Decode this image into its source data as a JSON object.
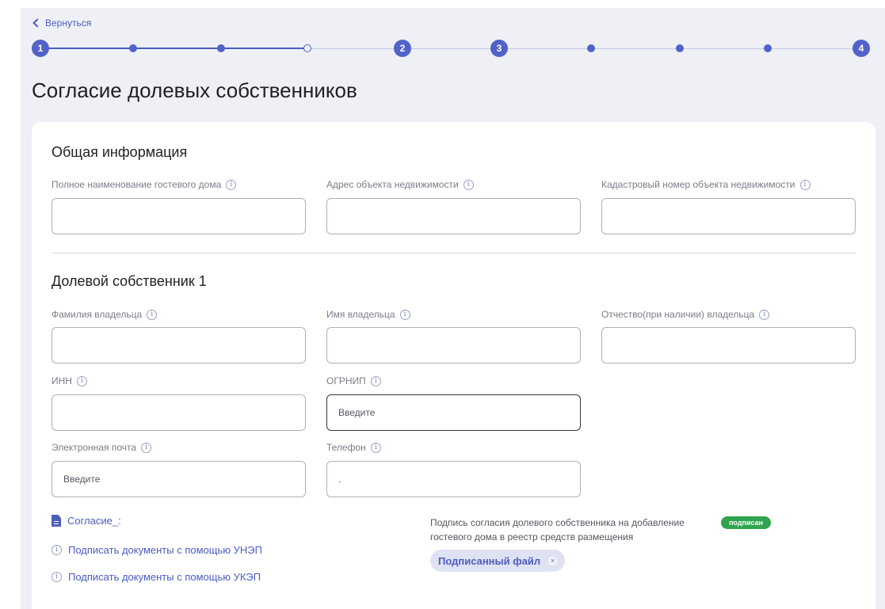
{
  "header": {
    "back_label": "Вернуться",
    "title": "Согласие долевых собственников"
  },
  "stepper": {
    "steps": [
      "1",
      "2",
      "3",
      "4"
    ]
  },
  "general_section": {
    "title": "Общая информация",
    "fields": [
      {
        "label": "Полное наименование гостевого дома",
        "value": ""
      },
      {
        "label": "Адрес объекта недвижимости",
        "value": ""
      },
      {
        "label": "Кадастровый номер объекта недвижимости",
        "value": ""
      }
    ]
  },
  "owner_section": {
    "title": "Долевой собственник 1",
    "fields": [
      {
        "label": "Фамилия владельца",
        "value": ""
      },
      {
        "label": "Имя владельца",
        "value": ""
      },
      {
        "label": "Отчество(при наличии) владельца",
        "value": ""
      },
      {
        "label": "ИНН",
        "value": ""
      },
      {
        "label": "ОГРНИП",
        "placeholder": "Введите"
      },
      {
        "label": "Электронная почта",
        "placeholder": "Введите"
      },
      {
        "label": "Телефон",
        "placeholder": "."
      }
    ]
  },
  "documents": {
    "consent_file": "Согласие_:",
    "sign_unep": "Подписать документы с помощью УНЭП",
    "sign_ukep": "Подписать документы с помощью УКЭП",
    "sign_description": "Подпись согласия долевого собственника на добавление гостевого дома в реестр средств размещения",
    "status": "подписан",
    "status_color": "#2fa44f",
    "signed_file": "Подписанный файл"
  },
  "colors": {
    "accent": "#4b5dbd",
    "background": "#eef0f6"
  },
  "icons": {
    "back": "chevron-left-icon",
    "info": "info-icon",
    "document": "document-icon",
    "close": "close-icon"
  }
}
